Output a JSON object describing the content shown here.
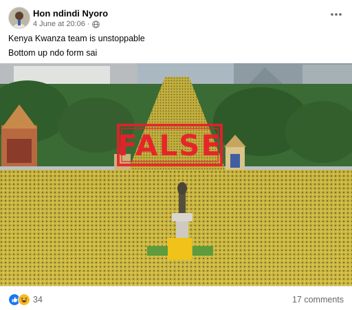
{
  "post": {
    "author": "Hon ndindi Nyoro",
    "timestamp": "4 June at 20:06",
    "privacy_icon": "globe-icon",
    "text_lines": [
      "Kenya Kwanza team is unstoppable",
      "Bottom up ndo form sai"
    ]
  },
  "image": {
    "stamp_text": "FALSE",
    "stamp_color": "#e8202a",
    "crowd_color": "#c9b437"
  },
  "footer": {
    "reaction_icons": [
      "like-icon",
      "haha-icon"
    ],
    "reaction_count": "34",
    "comments_label": "17 comments"
  },
  "colors": {
    "like_blue": "#1877f2",
    "haha_yellow": "#f7b928",
    "meta_gray": "#65676b"
  }
}
